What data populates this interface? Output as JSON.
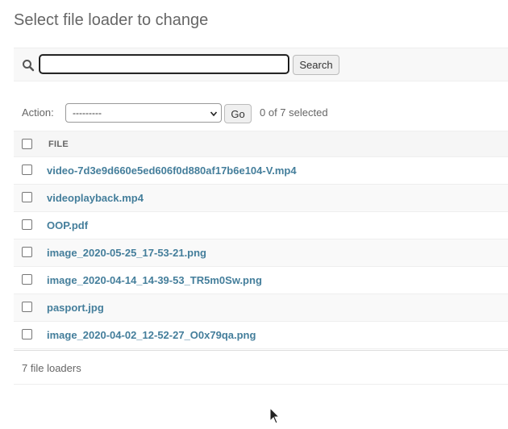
{
  "header": {
    "title": "Select file loader to change"
  },
  "search": {
    "value": "",
    "button_label": "Search",
    "icon": "search-icon"
  },
  "actions": {
    "label": "Action:",
    "selected_option": "---------",
    "go_label": "Go",
    "selected_count": "0 of 7 selected"
  },
  "table": {
    "column_header": "FILE",
    "rows": [
      {
        "file": "video-7d3e9d660e5ed606f0d880af17b6e104-V.mp4"
      },
      {
        "file": "videoplayback.mp4"
      },
      {
        "file": "OOP.pdf"
      },
      {
        "file": "image_2020-05-25_17-53-21.png"
      },
      {
        "file": "image_2020-04-14_14-39-53_TR5m0Sw.png"
      },
      {
        "file": "pasport.jpg"
      },
      {
        "file": "image_2020-04-02_12-52-27_O0x79qa.png"
      }
    ]
  },
  "footer": {
    "count_text": "7 file loaders"
  },
  "colors": {
    "link": "#447e9b",
    "muted_text": "#666666",
    "toolbar_bg": "#f8f8f8"
  }
}
